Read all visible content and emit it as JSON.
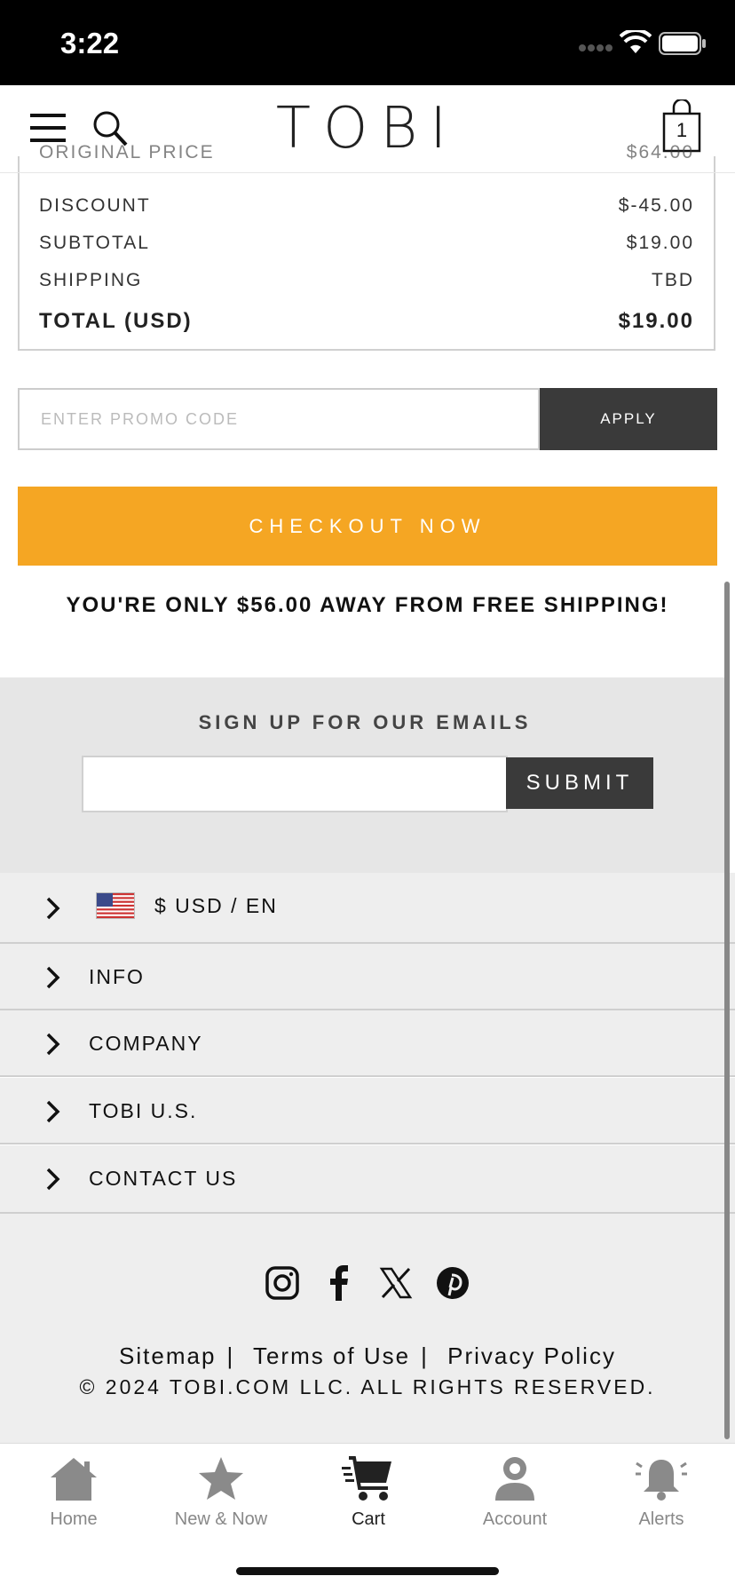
{
  "status_bar": {
    "time": "3:22"
  },
  "header": {
    "logo": "TOBI",
    "bag_count": "1"
  },
  "summary": {
    "rows": [
      {
        "label": "ORIGINAL PRICE",
        "value": "$64.00"
      },
      {
        "label": "DISCOUNT",
        "value": "$-45.00"
      },
      {
        "label": "SUBTOTAL",
        "value": "$19.00"
      },
      {
        "label": "SHIPPING",
        "value": "TBD"
      }
    ],
    "total_label": "TOTAL (USD)",
    "total_value": "$19.00"
  },
  "promo": {
    "placeholder": "ENTER PROMO CODE",
    "apply_label": "APPLY"
  },
  "checkout": {
    "label": "CHECKOUT NOW",
    "color": "#f5a623"
  },
  "free_shipping_message": "YOU'RE ONLY $56.00 AWAY FROM FREE SHIPPING!",
  "email_signup": {
    "title": "SIGN UP FOR OUR EMAILS",
    "submit_label": "SUBMIT"
  },
  "accordion": {
    "currency": "$ USD / EN",
    "items": [
      "INFO",
      "COMPANY",
      "TOBI U.S.",
      "CONTACT US"
    ]
  },
  "footer": {
    "social_icons": [
      "instagram-icon",
      "facebook-icon",
      "x-icon",
      "pinterest-icon"
    ],
    "links": [
      "Sitemap",
      "Terms of Use",
      "Privacy Policy"
    ],
    "copyright": "© 2024 TOBI.COM LLC. ALL RIGHTS RESERVED."
  },
  "tab_bar": {
    "tabs": [
      {
        "label": "Home",
        "icon": "home-icon"
      },
      {
        "label": "New & Now",
        "icon": "star-icon"
      },
      {
        "label": "Cart",
        "icon": "cart-icon",
        "active": true
      },
      {
        "label": "Account",
        "icon": "account-icon"
      },
      {
        "label": "Alerts",
        "icon": "alerts-icon"
      }
    ]
  }
}
